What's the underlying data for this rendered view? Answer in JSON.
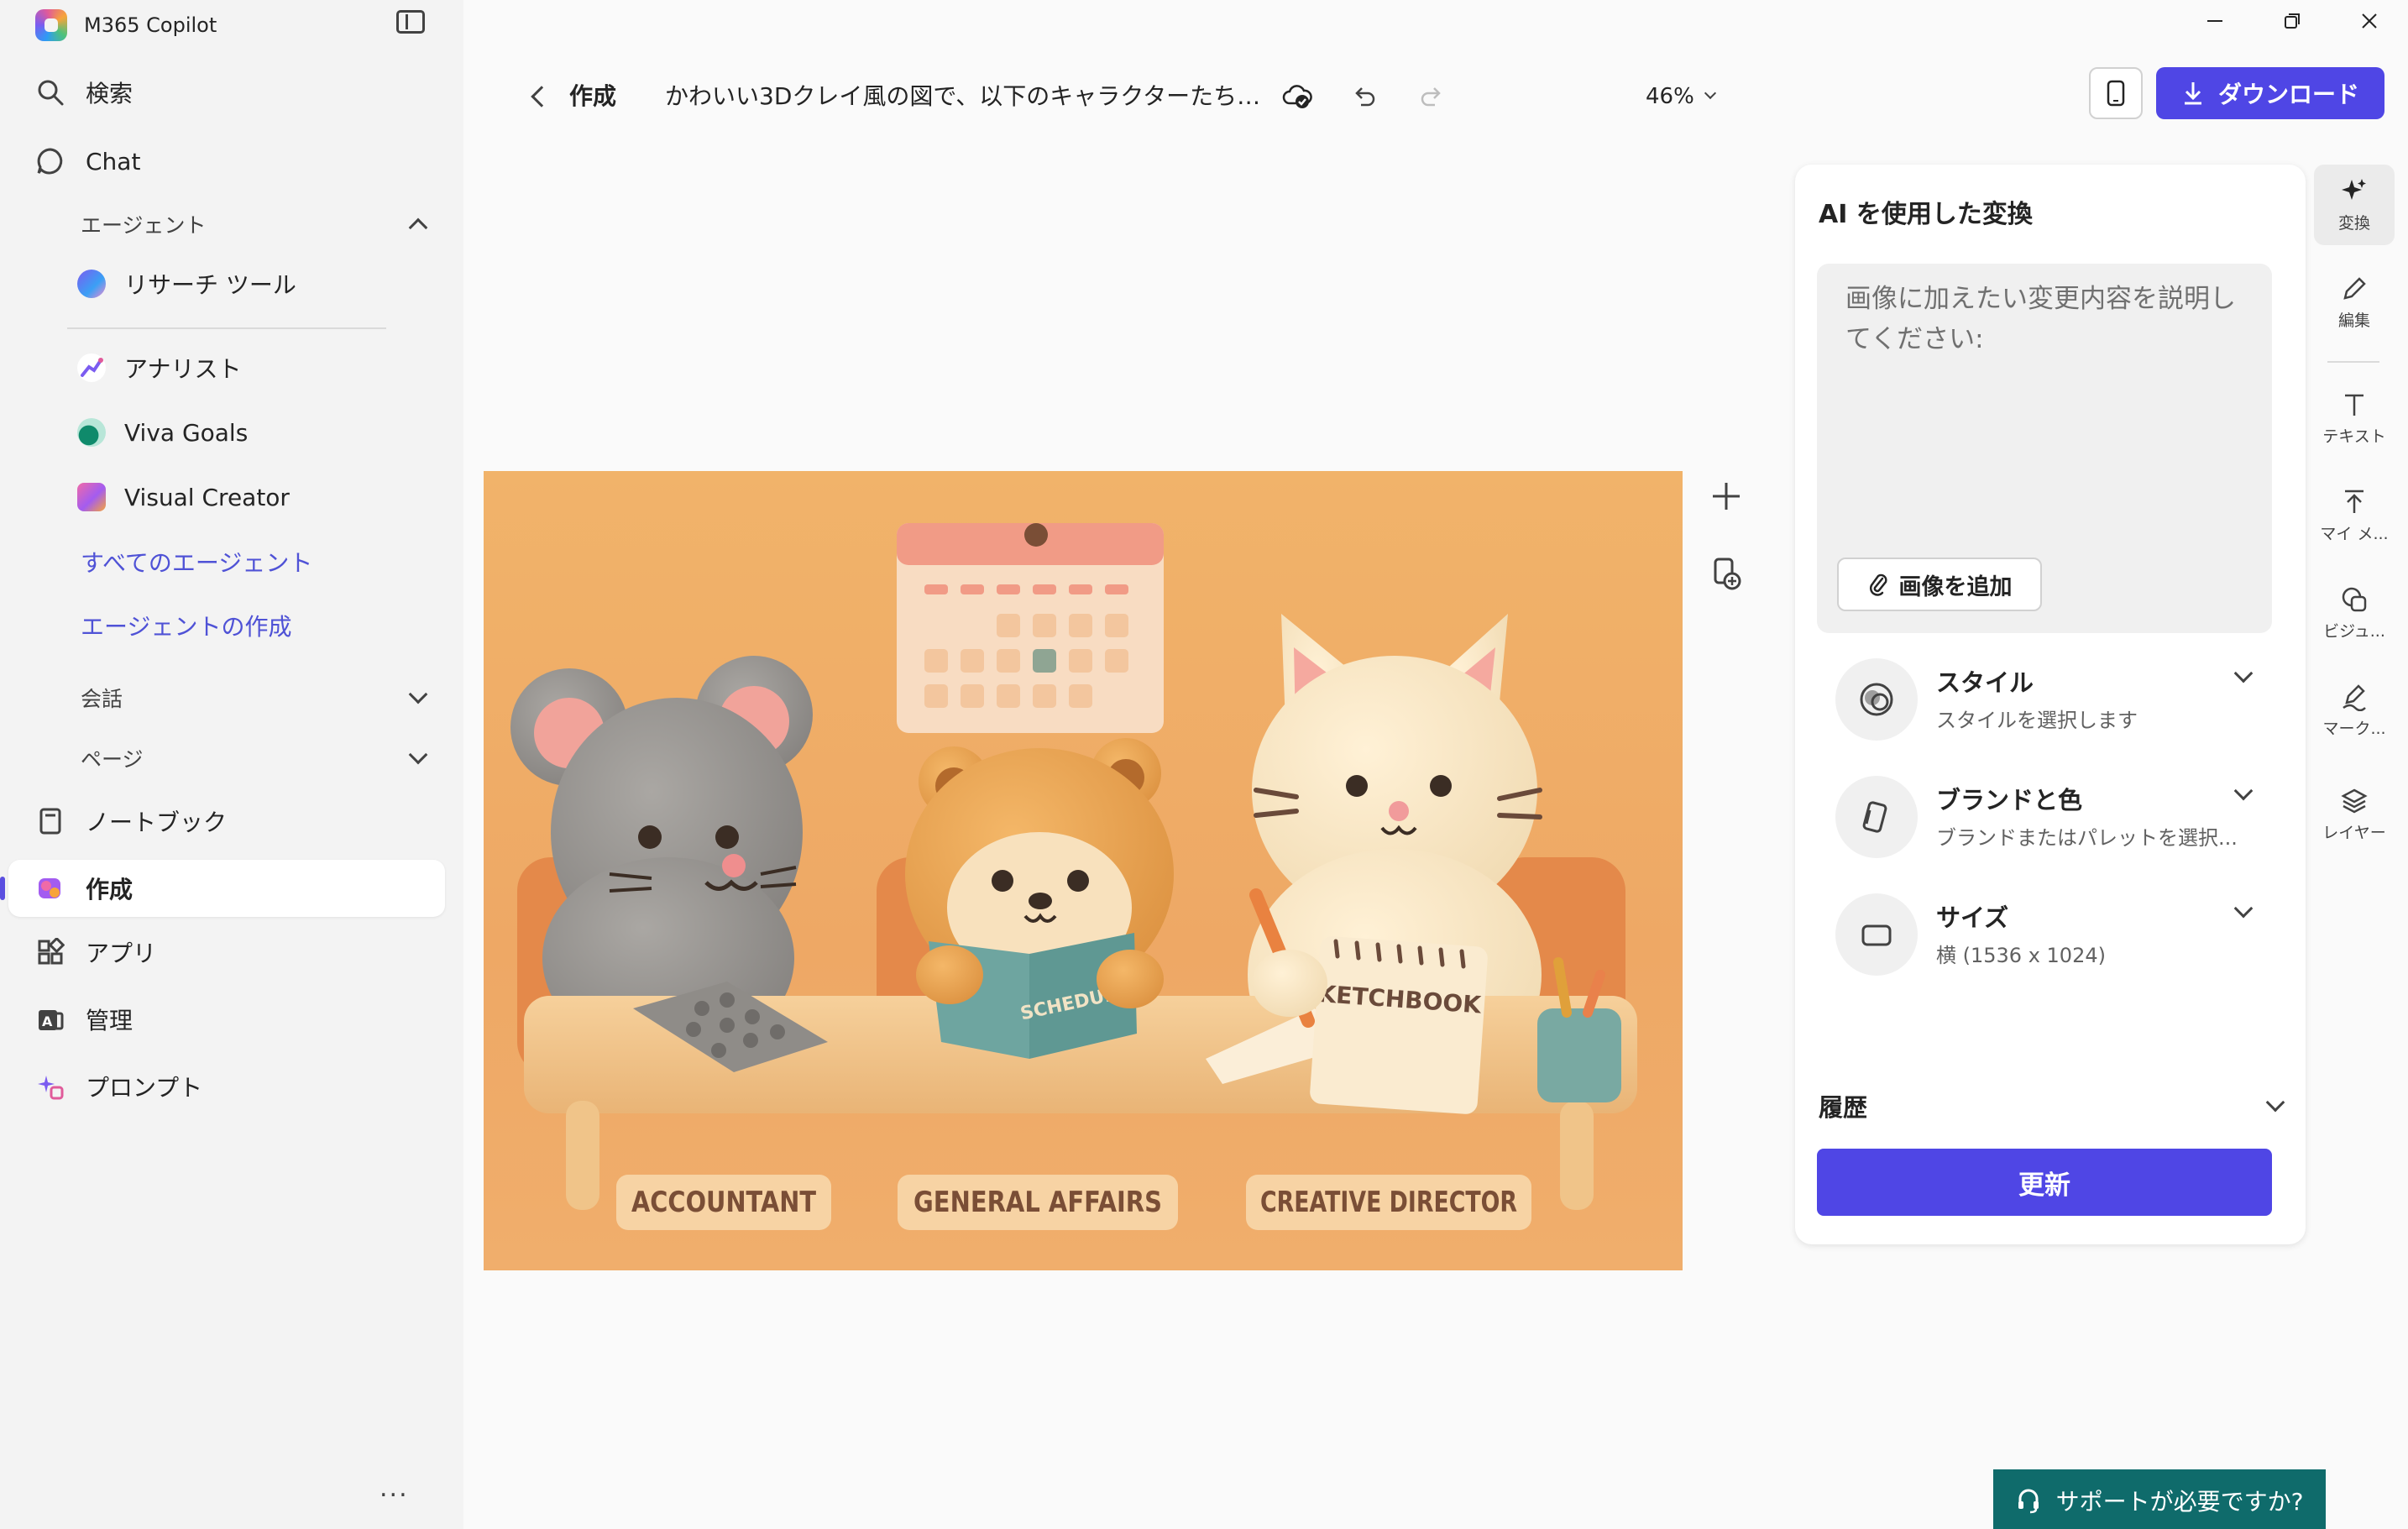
{
  "app": {
    "title": "M365 Copilot"
  },
  "sidebar": {
    "search_label": "検索",
    "chat_label": "Chat",
    "agents_heading": "エージェント",
    "agents": [
      {
        "label": "リサーチ ツール",
        "icon": "research-tool-icon"
      },
      {
        "label": "アナリスト",
        "icon": "analyst-icon"
      },
      {
        "label": "Viva Goals",
        "icon": "viva-goals-icon"
      },
      {
        "label": "Visual Creator",
        "icon": "visual-creator-icon"
      }
    ],
    "all_agents_link": "すべてのエージェント",
    "create_agent_link": "エージェントの作成",
    "conversations_heading": "会話",
    "pages_heading": "ページ",
    "notebook_label": "ノートブック",
    "create_label": "作成",
    "apps_label": "アプリ",
    "admin_label": "管理",
    "prompts_label": "プロンプト",
    "more_label": "..."
  },
  "toolbar": {
    "back_crumb": "作成",
    "doc_title": "かわいい3Dクレイ風の図で、以下のキャラクターたち…",
    "zoom": "46%",
    "download_label": "ダウンロード"
  },
  "canvas": {
    "notebook_text": "SCHEDULE",
    "sketchbook_text": "SKETCHBOOK",
    "name_plates": [
      "ACCOUNTANT",
      "GENERAL AFFAIRS",
      "CREATIVE DIRECTOR"
    ]
  },
  "panel": {
    "title": "AI を使用した変換",
    "prompt_placeholder": "画像に加えたい変更内容を説明してください:",
    "add_image_label": "画像を追加",
    "options": [
      {
        "title": "スタイル",
        "subtitle": "スタイルを選択します",
        "icon": "style-icon"
      },
      {
        "title": "ブランドと色",
        "subtitle": "ブランドまたはパレットを選択...",
        "icon": "brand-icon"
      },
      {
        "title": "サイズ",
        "subtitle": "横 (1536 x 1024)",
        "icon": "size-icon"
      }
    ],
    "history_label": "履歴",
    "update_label": "更新"
  },
  "rail": [
    {
      "label": "変換",
      "icon": "sparkle-icon"
    },
    {
      "label": "編集",
      "icon": "pencil-icon"
    },
    {
      "label": "テキスト",
      "icon": "text-icon"
    },
    {
      "label": "マイ メ...",
      "icon": "upload-icon"
    },
    {
      "label": "ビジュ...",
      "icon": "visuals-icon"
    },
    {
      "label": "マーク...",
      "icon": "markup-icon"
    },
    {
      "label": "レイヤー",
      "icon": "layers-icon"
    }
  ],
  "support": {
    "label": "サポートが必要ですか?"
  },
  "colors": {
    "accent": "#4f46e5",
    "support": "#0f6b6b",
    "canvas_bg": "#f1b36a"
  }
}
